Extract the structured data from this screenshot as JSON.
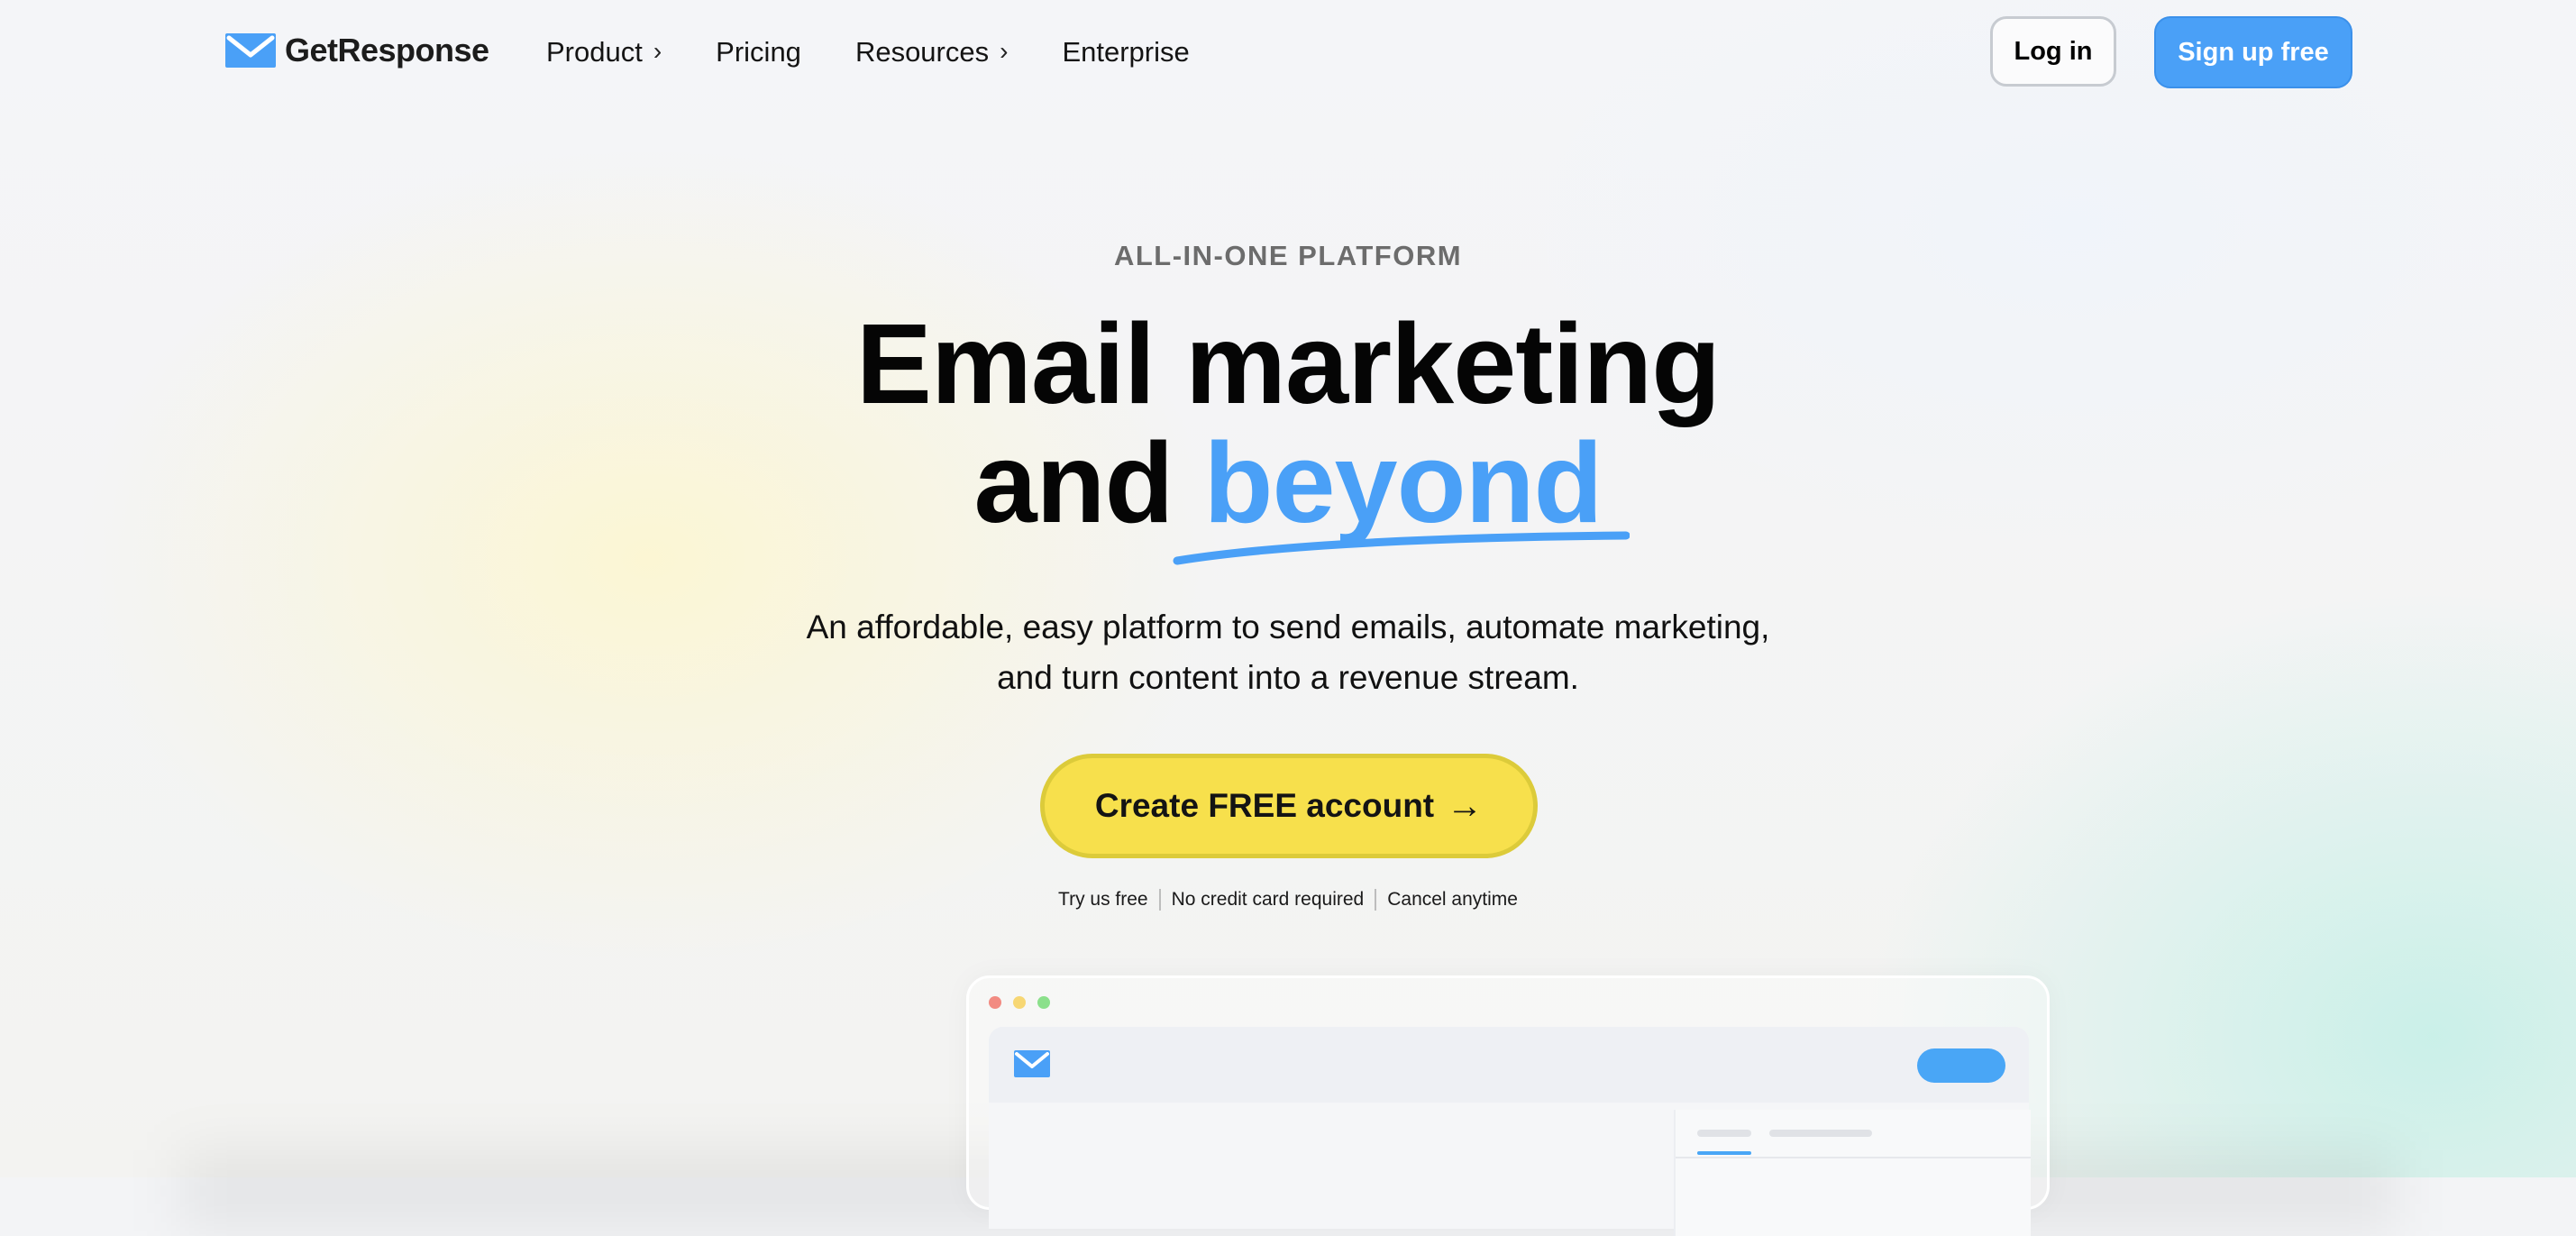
{
  "brand": {
    "name": "GetResponse",
    "accent": "#4aa0f7",
    "cta_color": "#f7e04c"
  },
  "nav": {
    "items": [
      {
        "label": "Product",
        "has_chevron": true
      },
      {
        "label": "Pricing",
        "has_chevron": false
      },
      {
        "label": "Resources",
        "has_chevron": true
      },
      {
        "label": "Enterprise",
        "has_chevron": false
      }
    ],
    "chevron_glyph": "›",
    "login_label": "Log in",
    "signup_label": "Sign up free"
  },
  "hero": {
    "eyebrow": "ALL-IN-ONE PLATFORM",
    "headline_line1": "Email marketing",
    "headline_line2_prefix": "and",
    "headline_line2_accent": "beyond",
    "subtext_line1": "An affordable, easy platform to send emails, automate marketing,",
    "subtext_line2": "and turn content into a revenue stream.",
    "cta_label": "Create FREE account",
    "cta_arrow": "→",
    "trust": [
      "Try us free",
      "No credit card required",
      "Cancel anytime"
    ]
  },
  "preview": {
    "window_dots": [
      "#f28b82",
      "#f7d774",
      "#8be08b"
    ],
    "icons": [
      "envelope-logo-icon"
    ]
  }
}
